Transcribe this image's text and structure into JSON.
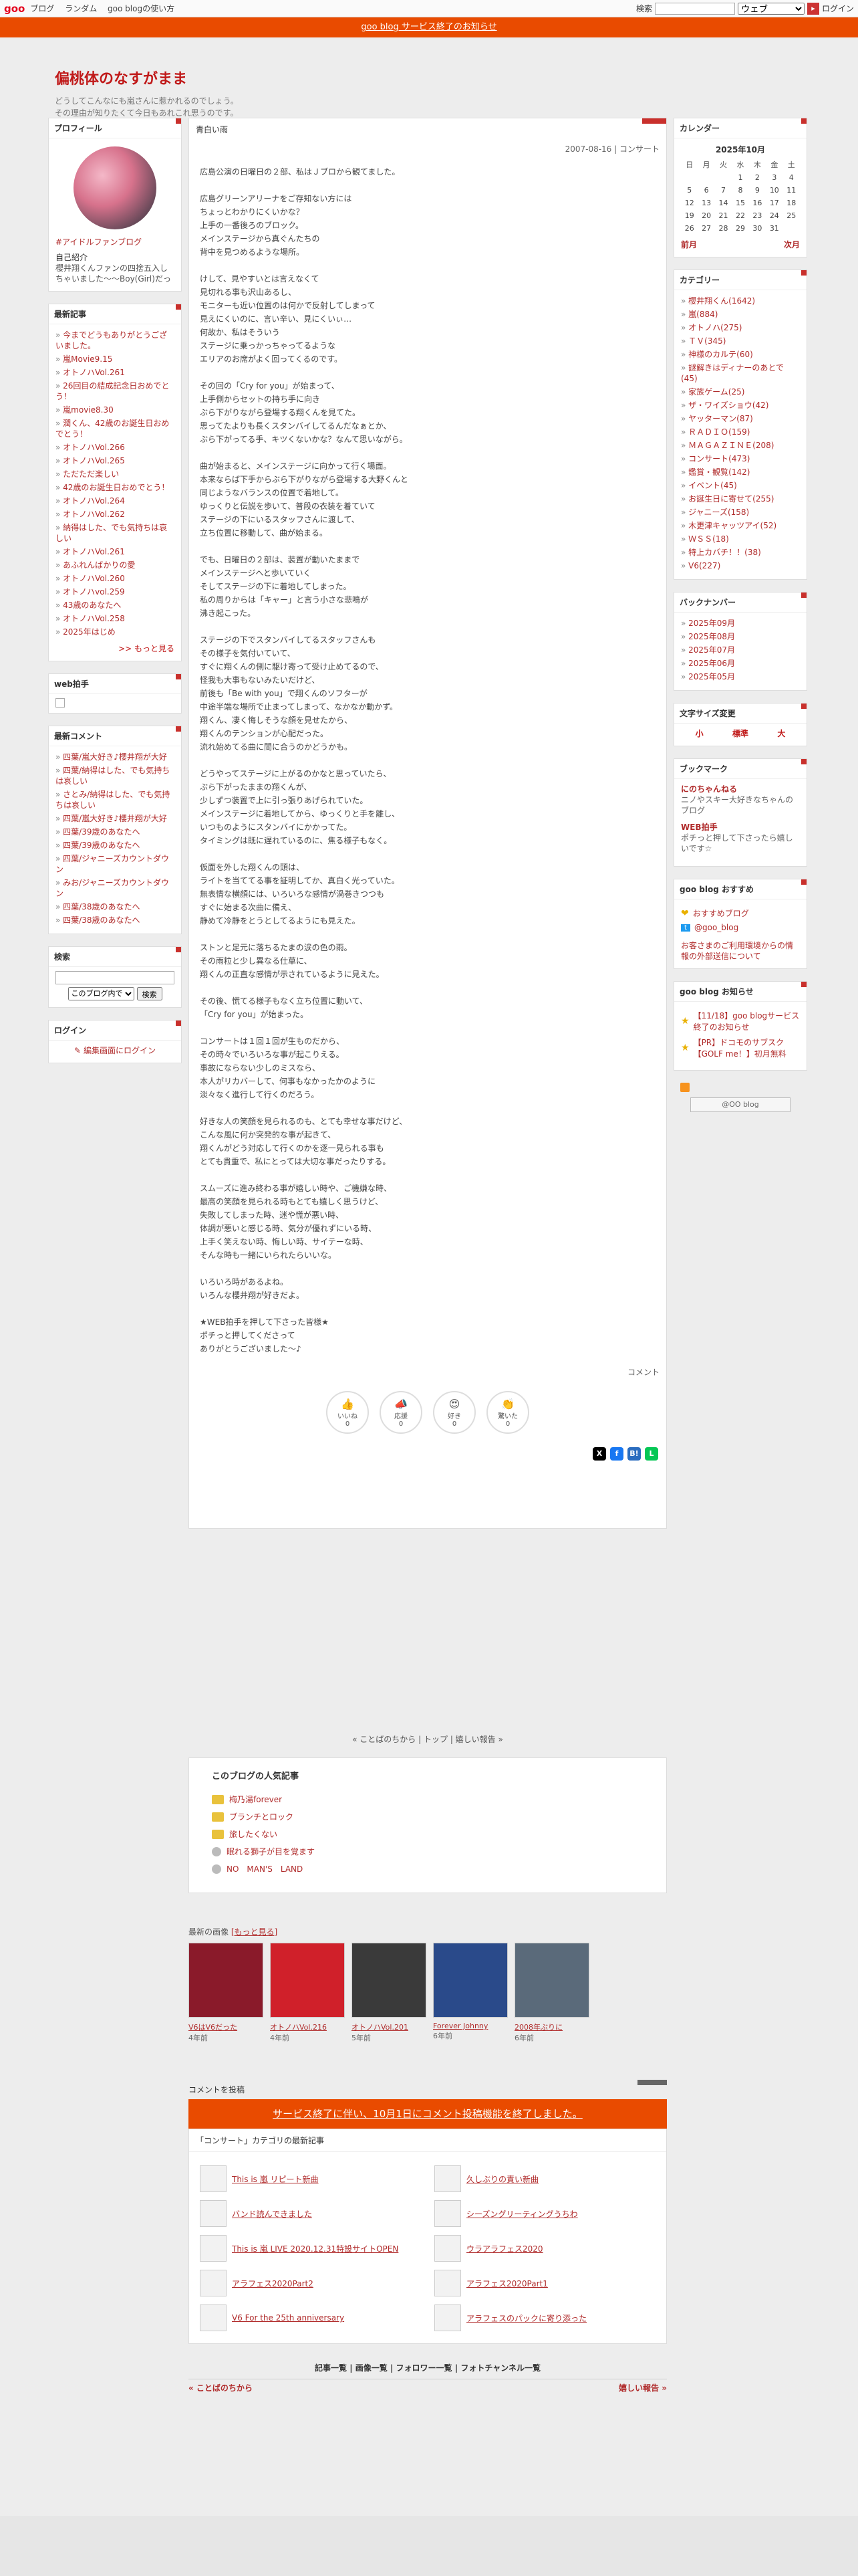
{
  "topbar": {
    "logo": "goo",
    "nav": [
      "ブログ",
      "ランダム",
      "goo blogの使い方"
    ],
    "search_label": "検索",
    "search_scope": "ウェブ",
    "login": "ログイン"
  },
  "notice": "goo blog サービス終了のお知らせ",
  "blog": {
    "title": "偏桃体のなすがまま",
    "desc1": "どうしてこんなにも嵐さんに惹かれるのでしょう。",
    "desc2": "その理由が知りたくて今日もあれこれ思うのです。"
  },
  "profile": {
    "heading": "プロフィール",
    "name": "#アイドルファンブログ",
    "intro_label": "自己紹介",
    "intro": "櫻井翔くんファンの四捨五入しちゃいました～～Boy(Girl)だった私が夢中になったの？一番の推しは櫻井翔くんです。"
  },
  "recent": {
    "heading": "最新記事",
    "items": [
      "今までどうもありがとうございました。",
      "嵐Movie9.15",
      "オトノハVol.261",
      "26回目の結成記念日おめでとう！",
      "嵐movie8.30",
      "潤くん、42歳のお誕生日おめでとう！",
      "オトノハVol.266",
      "オトノハVol.265",
      "ただただ楽しい",
      "42歳のお誕生日おめでとう！",
      "オトノハVol.264",
      "オトノハVol.262",
      "納得はした、でも気持ちは哀しい",
      "オトノハVol.261",
      "あふれんばかりの愛",
      "オトノハVol.260",
      "オトノハvol.259",
      "43歳のあなたへ",
      "オトノハVol.258",
      "2025年はじめ"
    ],
    "more": ">> もっと見る"
  },
  "web_helper": {
    "heading": "web拍手"
  },
  "recent_comments": {
    "heading": "最新コメント",
    "items": [
      "四葉/嵐大好き♪櫻井翔が大好",
      "四葉/納得はした、でも気持ちは哀しい",
      "さとみ/納得はした、でも気持ちは哀しい",
      "四葉/嵐大好き♪櫻井翔が大好",
      "四葉/39歳のあなたへ",
      "四葉/39歳のあなたへ",
      "四葉/ジャニーズカウントダウン",
      "みお/ジャニーズカウントダウン",
      "四葉/38歳のあなたへ",
      "四葉/38歳のあなたへ"
    ]
  },
  "search": {
    "heading": "検索",
    "scope": "このブログ内で",
    "button": "検索"
  },
  "login_box": {
    "heading": "ログイン",
    "link": "編集画面にログイン"
  },
  "article": {
    "title": "青白い雨",
    "meta": "2007-08-16 | コンサート",
    "body": "広島公演の日曜日の２部、私はＪブロから観てました。\n\n広島グリーンアリーナをご存知ない方には\nちょっとわかりにくいかな？\n上手の一番後ろのブロック。\nメインステージから真ぐんたちの\n背中を見つめるような場所。\n\nけして、見やすいとは言えなくて\n見切れる事も沢山あるし、\nモニターも近い位置のは何かで反射してしまって\n見えにくいのに、言い辛い、見にくいぃ…\n何故か、私はそういう\nステージに乗っかっちゃってるような\nエリアのお席がよく回ってくるのです。\n\nその回の「Cry for you」が始まって、\n上手側からセットの持ち手に向き\nぶら下がりながら登場する翔くんを見てた。\n思ってたよりも長くスタンバイしてるんだなぁとか、\nぶら下がってる手、キツくないかな？なんて思いながら。\n\n曲が始まると、メインステージに向かって行く場面。\n本来ならば下手からぶら下がりながら登場する大野くんと\n同じようなバランスの位置で着地して。\nゆっくりと伝説を歩いて、普段の衣装を着ていて\nステージの下にいるスタッフさんに渡して、\n立ち位置に移動して、曲が始まる。\n\nでも、日曜日の２部は、装置が動いたままで\nメインステージへと歩いていく\nそしてステージの下に着地してしまった。\n私の周りからは「キャー」と言う小さな悲鳴が\n沸き起こった。\n\nステージの下でスタンバイしてるスタッフさんも\nその様子を気付いていて、\nすぐに翔くんの側に駆け寄って受け止めてるので、\n怪我も大事もないみたいだけど、\n前後も「Be with you」で翔くんのソフターが\n中途半端な場所で止まってしまって、なかなか動かず。\n翔くん、凄く悔しそうな顔を見せたから、\n翔くんのテンションが心配だった。\n流れ始めてる曲に間に合うのかどうかも。\n\nどうやってステージに上がるのかなと思っていたら、\nぶら下がったままの翔くんが、\n少しずつ装置で上に引っ張りあげられていた。\nメインステージに着地してから、ゆっくりと手を離し、\nいつものようにスタンバイにかかってた。\nタイミングは既に遅れているのに、焦る様子もなく。\n\n仮面を外した翔くんの頭は、\nライトを当ててる事を証明してか、真白く光っていた。\n無表情な横顔には、いろいろな感情が渦巻きつつも\nすぐに始まる次曲に備え、\n静めて冷静をとうとしてるようにも見えた。\n\nストンと足元に落ちるたまの涙の色の雨。\nその雨粒と少し異なる仕草に、\n翔くんの正直な感情が示されているように見えた。\n\nその後、慌てる様子もなく立ち位置に動いて、\n「Cry for you」が始まった。\n\nコンサートは１回１回が生ものだから、\nその時々でいろいろな事が起こりえる。\n事故にならない少しのミスなら、\n本人がリカバーして、何事もなかったかのように\n淡々なく進行して行くのだろう。\n\n好きな人の笑顔を見られるのも、とても幸せな事だけど、\nこんな風に何か突発的な事が起きて、\n翔くんがどう対応して行くのかを逐一見られる事も\nとても貴重で、私にとっては大切な事だったりする。\n\nスムーズに進み終わる事が嬉しい時や、ご機嫌な時、\n最高の笑顔を見られる時もとても嬉しく思うけど、\n失敗してしまった時、迷や慌が悪い時、\n体調が悪いと感じる時、気分が優れずにいる時、\n上手く笑えない時、悔しい時、サイテーな時、\nそんな時も一緒にいられたらいいな。\n\nいろいろ時があるよね。\nいろんな櫻井翔が好きだよ。\n\n★WEB拍手を押して下さった皆様★\nポチっと押してくださって\nありがとうございました～♪",
    "comment_link": "コメント",
    "reactions": [
      {
        "label": "いいね",
        "count": "0"
      },
      {
        "label": "応援",
        "count": "0"
      },
      {
        "label": "好き",
        "count": "0"
      },
      {
        "label": "驚いた",
        "count": "0"
      }
    ]
  },
  "pager": {
    "prev": "« ことばのちから",
    "top": "トップ",
    "next": "嬉しい報告 »"
  },
  "popular": {
    "heading": "このブログの人気記事",
    "items": [
      "梅乃湯forever",
      "ブランチとロック",
      "旅したくない",
      "眠れる獅子が目を覚ます",
      "NO　MAN'S　LAND"
    ]
  },
  "images": {
    "label": "最新の画像",
    "more": "[もっと見る]",
    "thumbs": [
      {
        "title": "V6はV6だった",
        "ago": "4年前"
      },
      {
        "title": "オトノハVol.216",
        "ago": "4年前"
      },
      {
        "title": "オトノハVol.201",
        "ago": "5年前"
      },
      {
        "title": "Forever Johnny",
        "ago": "6年前"
      },
      {
        "title": "2008年ぶりに",
        "ago": "6年前"
      }
    ]
  },
  "comment_post": {
    "label": "コメントを投稿",
    "end_notice": "サービス終了に伴い、10月1日にコメント投稿機能を終了しました。"
  },
  "category_recent": {
    "heading": "「コンサート」カテゴリの最新記事",
    "items": [
      "This is 嵐 リピート新曲",
      "久しぶりの責い新曲",
      "バンド読んできました",
      "シーズングリーティングうちわ",
      "This is 嵐 LIVE 2020.12.31特設サイトOPEN",
      "ウラアラフェス2020",
      "アラフェス2020Part2",
      "アラフェス2020Part1",
      "V6 For the 25th anniversary",
      "アラフェスのパックに寄り添った"
    ]
  },
  "footer_nav": {
    "links": [
      "記事一覧",
      "画像一覧",
      "フォロワー一覧",
      "フォトチャンネル一覧"
    ],
    "prev": "« ことばのちから",
    "next": "嬉しい報告 »"
  },
  "calendar": {
    "heading": "カレンダー",
    "caption": "2025年10月",
    "weekdays": [
      "日",
      "月",
      "火",
      "水",
      "木",
      "金",
      "土"
    ],
    "weeks": [
      [
        "",
        "",
        "",
        "1",
        "2",
        "3",
        "4"
      ],
      [
        "5",
        "6",
        "7",
        "8",
        "9",
        "10",
        "11"
      ],
      [
        "12",
        "13",
        "14",
        "15",
        "16",
        "17",
        "18"
      ],
      [
        "19",
        "20",
        "21",
        "22",
        "23",
        "24",
        "25"
      ],
      [
        "26",
        "27",
        "28",
        "29",
        "30",
        "31",
        ""
      ]
    ],
    "prev": "前月",
    "next": "次月"
  },
  "categories": {
    "heading": "カテゴリー",
    "items": [
      "櫻井翔くん(1642)",
      "嵐(884)",
      "オトノハ(275)",
      "ＴＶ(345)",
      "神様のカルテ(60)",
      "謎解きはディナーのあとで(45)",
      "家族ゲーム(25)",
      "ザ・ワイズショウ(42)",
      "ヤッターマン(87)",
      "ＲＡＤＩＯ(159)",
      "ＭＡＧＡＺＩＮＥ(208)",
      "コンサート(473)",
      "鑑賞・観覧(142)",
      "イベント(45)",
      "お誕生日に寄せて(255)",
      "ジャニーズ(158)",
      "木更津キャッツアイ(52)",
      "ＷＳＳ(18)",
      "特上カバチ！！(38)",
      "V6(227)"
    ]
  },
  "backnumber": {
    "heading": "バックナンバー",
    "items": [
      "2025年09月",
      "2025年08月",
      "2025年07月",
      "2025年06月",
      "2025年05月"
    ]
  },
  "font_size": {
    "heading": "文字サイズ変更",
    "options": [
      "小",
      "標準",
      "大"
    ]
  },
  "bookmarks": {
    "heading": "ブックマーク",
    "items": [
      {
        "name": "にのちゃんねる",
        "desc": "ニノやスキー大好きなちゃんのブログ"
      },
      {
        "name": "WEB拍手",
        "desc": "ポチっと押して下さったら嬉しいです☆"
      }
    ]
  },
  "goo_recommend": {
    "heading": "goo blog おすすめ",
    "items": [
      "おすすめブログ",
      "@goo_blog"
    ],
    "notice": "お客さまのご利用環境からの情報の外部送信について"
  },
  "goo_notice": {
    "heading": "goo blog お知らせ",
    "items": [
      "【11/18】goo blogサービス終了のお知らせ",
      "【PR】ドコモのサブスク【GOLF me！】初月無料"
    ],
    "badge": "@OO blog"
  }
}
